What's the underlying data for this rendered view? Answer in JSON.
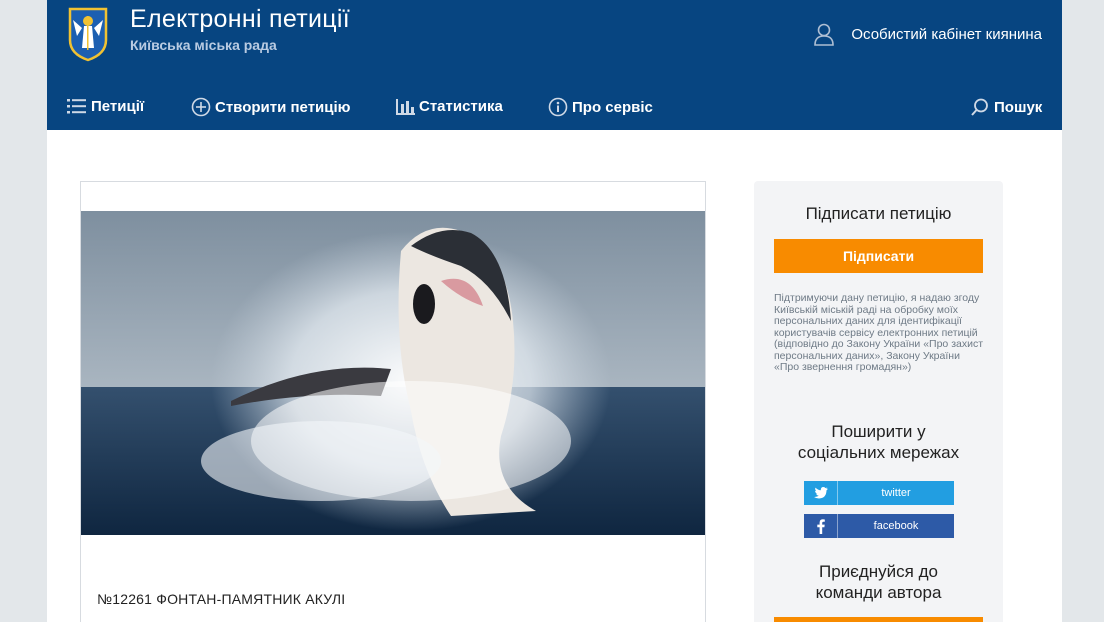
{
  "header": {
    "title": "Електронні петиції",
    "subtitle": "Київська міська рада",
    "account_label": "Особистий кабінет киянина"
  },
  "nav": [
    {
      "label": "Петиції",
      "icon": "list-icon"
    },
    {
      "label": "Створити петицію",
      "icon": "plus-circle-icon"
    },
    {
      "label": "Статистика",
      "icon": "bar-chart-icon"
    },
    {
      "label": "Про сервіс",
      "icon": "info-icon"
    },
    {
      "label": "Пошук",
      "icon": "search-icon"
    }
  ],
  "petition": {
    "title": "№12261 ФОНТАН-ПАМЯТНИК АКУЛІ"
  },
  "sidebar": {
    "sign_heading": "Підписати петицію",
    "sign_button": "Підписати",
    "consent_text": "Підтримуючи дану петицію, я надаю згоду Київській міській раді на обробку моїх персональних даних для ідентифікації користувачів сервісу електронних петицій (відповідно до Закону України «Про захист персональних даних», Закону України «Про звернення громадян»)",
    "share_heading_line1": "Поширити у",
    "share_heading_line2": "соціальних мережах",
    "twitter_label": "twitter",
    "facebook_label": "facebook",
    "join_heading_line1": "Приєднуйся до",
    "join_heading_line2": "команди автора"
  },
  "colors": {
    "header_bg": "#074581",
    "accent_orange": "#f88b00",
    "twitter_blue": "#229ee1",
    "facebook_blue": "#2d5aa7"
  }
}
